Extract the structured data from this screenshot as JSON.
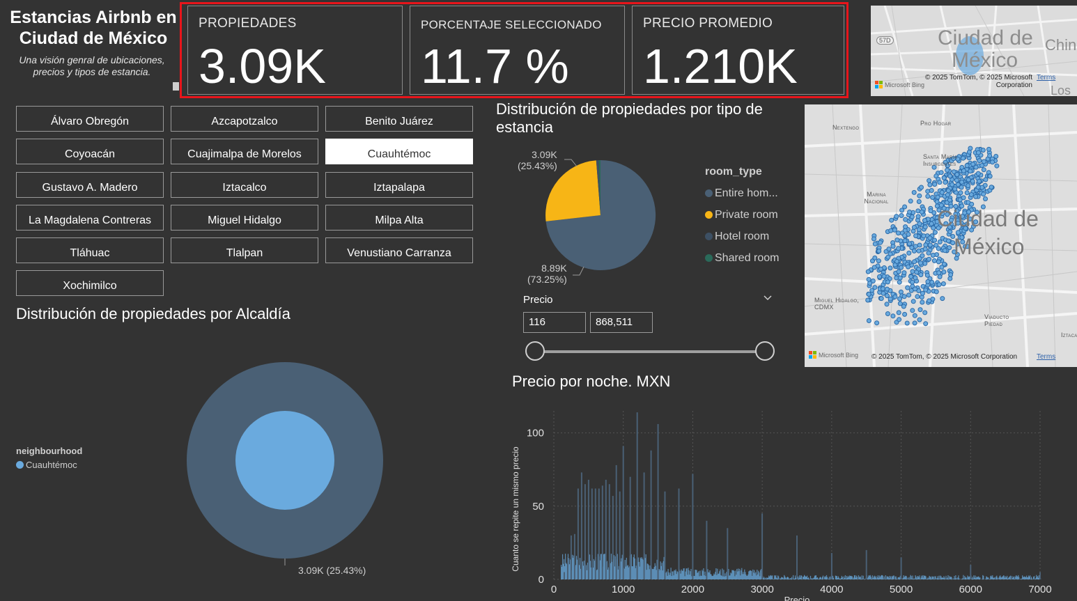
{
  "header": {
    "title": "Estancias Airbnb en Ciudad de México",
    "subtitle": "Una visión genral de ubicaciones, precios y tipos de estancia."
  },
  "kpis": [
    {
      "label": "PROPIEDADES",
      "value": "3.09K"
    },
    {
      "label": "PORCENTAJE SELECCIONADO",
      "value": "11.7 %"
    },
    {
      "label": "PRECIO PROMEDIO",
      "value": "1.210K"
    }
  ],
  "minimap": {
    "city_label_1": "Ciudad de",
    "city_label_2": "México",
    "side_label_1": "Chin",
    "side_label_2": "Los",
    "road_badge": "57D",
    "credit": "© 2025 TomTom, © 2025 Microsoft Corporation",
    "terms": "Terms",
    "bing": "Microsoft Bing"
  },
  "alcaldias": [
    {
      "label": "Álvaro Obregón",
      "selected": false
    },
    {
      "label": "Azcapotzalco",
      "selected": false
    },
    {
      "label": "Benito Juárez",
      "selected": false
    },
    {
      "label": "Coyoacán",
      "selected": false
    },
    {
      "label": "Cuajimalpa de Morelos",
      "selected": false
    },
    {
      "label": "Cuauhtémoc",
      "selected": true
    },
    {
      "label": "Gustavo A. Madero",
      "selected": false
    },
    {
      "label": "Iztacalco",
      "selected": false
    },
    {
      "label": "Iztapalapa",
      "selected": false
    },
    {
      "label": "La Magdalena Contreras",
      "selected": false
    },
    {
      "label": "Miguel Hidalgo",
      "selected": false
    },
    {
      "label": "Milpa Alta",
      "selected": false
    },
    {
      "label": "Tláhuac",
      "selected": false
    },
    {
      "label": "Tlalpan",
      "selected": false
    },
    {
      "label": "Venustiano Carranza",
      "selected": false
    },
    {
      "label": "Xochimilco",
      "selected": false
    }
  ],
  "pie_section": {
    "title": "Distribución de propiedades por tipo de estancia",
    "label_top_value": "3.09K",
    "label_top_pct": "(25.43%)",
    "label_bottom_value": "8.89K",
    "label_bottom_pct": "(73.25%)",
    "legend_title": "room_type",
    "legend": [
      {
        "label": "Entire hom...",
        "color": "#4a6075"
      },
      {
        "label": "Private room",
        "color": "#f7b516"
      },
      {
        "label": "Hotel room",
        "color": "#3d5064"
      },
      {
        "label": "Shared room",
        "color": "#2a6a5a"
      }
    ]
  },
  "price_slicer": {
    "label": "Precio",
    "min": "116",
    "max": "868,511"
  },
  "bigmap": {
    "labels": [
      "Nextengo",
      "Pro Hogar",
      "Santa María Insurgentes",
      "Marina Nacional",
      "Miguel Hidalgo, CDMX",
      "Viaducto Piedad",
      "Iztaca"
    ],
    "city_1": "Ciudad de",
    "city_2": "México",
    "credit": "© 2025 TomTom, © 2025 Microsoft Corporation",
    "terms": "Terms",
    "bing": "Microsoft Bing"
  },
  "donut_section": {
    "title": "Distribución de propiedades por Alcaldía",
    "legend_title": "neighbourhood",
    "legend_item": "Cuauhtémoc",
    "data_label": "3.09K (25.43%)",
    "colors": {
      "outer": "#4a6075",
      "inner": "#6aaade"
    }
  },
  "histogram": {
    "title": "Precio por noche. MXN",
    "ylabel": "Cuanto se repite un mismo precio",
    "xlabel": "Precio",
    "x_ticks": [
      "0",
      "1000",
      "2000",
      "3000",
      "4000",
      "5000",
      "6000",
      "7000"
    ],
    "y_ticks": [
      "0",
      "50",
      "100"
    ],
    "color": "#6aaade"
  },
  "chart_data": {
    "type": "bar",
    "title": "Precio por noche. MXN",
    "xlabel": "Precio",
    "ylabel": "Cuanto se repite un mismo precio",
    "xlim": [
      0,
      7000
    ],
    "ylim": [
      0,
      115
    ],
    "x": [
      150,
      200,
      250,
      300,
      350,
      400,
      450,
      500,
      550,
      600,
      650,
      700,
      750,
      800,
      850,
      900,
      950,
      1000,
      1100,
      1200,
      1300,
      1400,
      1500,
      1600,
      1800,
      2000,
      2200,
      2500,
      3000,
      3500,
      4000,
      4500,
      5000,
      6000,
      7000
    ],
    "values": [
      5,
      15,
      30,
      31,
      62,
      73,
      65,
      68,
      62,
      62,
      62,
      64,
      68,
      65,
      57,
      78,
      60,
      91,
      70,
      114,
      73,
      88,
      106,
      60,
      62,
      72,
      40,
      35,
      45,
      30,
      18,
      20,
      15,
      10,
      5
    ]
  }
}
